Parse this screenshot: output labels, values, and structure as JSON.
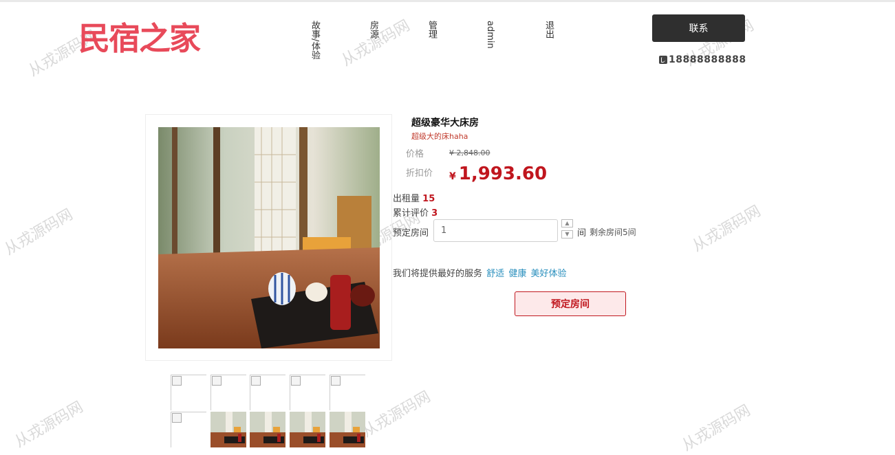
{
  "header": {
    "logo_text": "民宿之家",
    "nav": [
      "故事/体验",
      "房源",
      "管理",
      "admin",
      "退出"
    ],
    "contact_label": "联系",
    "phone": "18888888888"
  },
  "product": {
    "title": "超级豪华大床房",
    "subtitle": "超级大的床haha",
    "price_label": "价格",
    "old_price": "¥ 2,848.00",
    "discount_label": "折扣价",
    "currency": "¥",
    "price": "1,993.60",
    "rent_label": "出租量",
    "rent_count": "15",
    "review_label": "累计评价",
    "review_count": "3",
    "qty_label": "预定房间",
    "qty_value": "1",
    "unit": "间",
    "remaining": "剩余房间5间",
    "service_text": "我们将提供最好的服务",
    "service_tags": [
      "舒适",
      "健康",
      "美好体验"
    ],
    "book_label": "预定房间"
  },
  "watermark": "从戎源码网",
  "colors": {
    "brand": "#e84a5a",
    "accent": "#c0161e",
    "link": "#2a8fbd"
  }
}
